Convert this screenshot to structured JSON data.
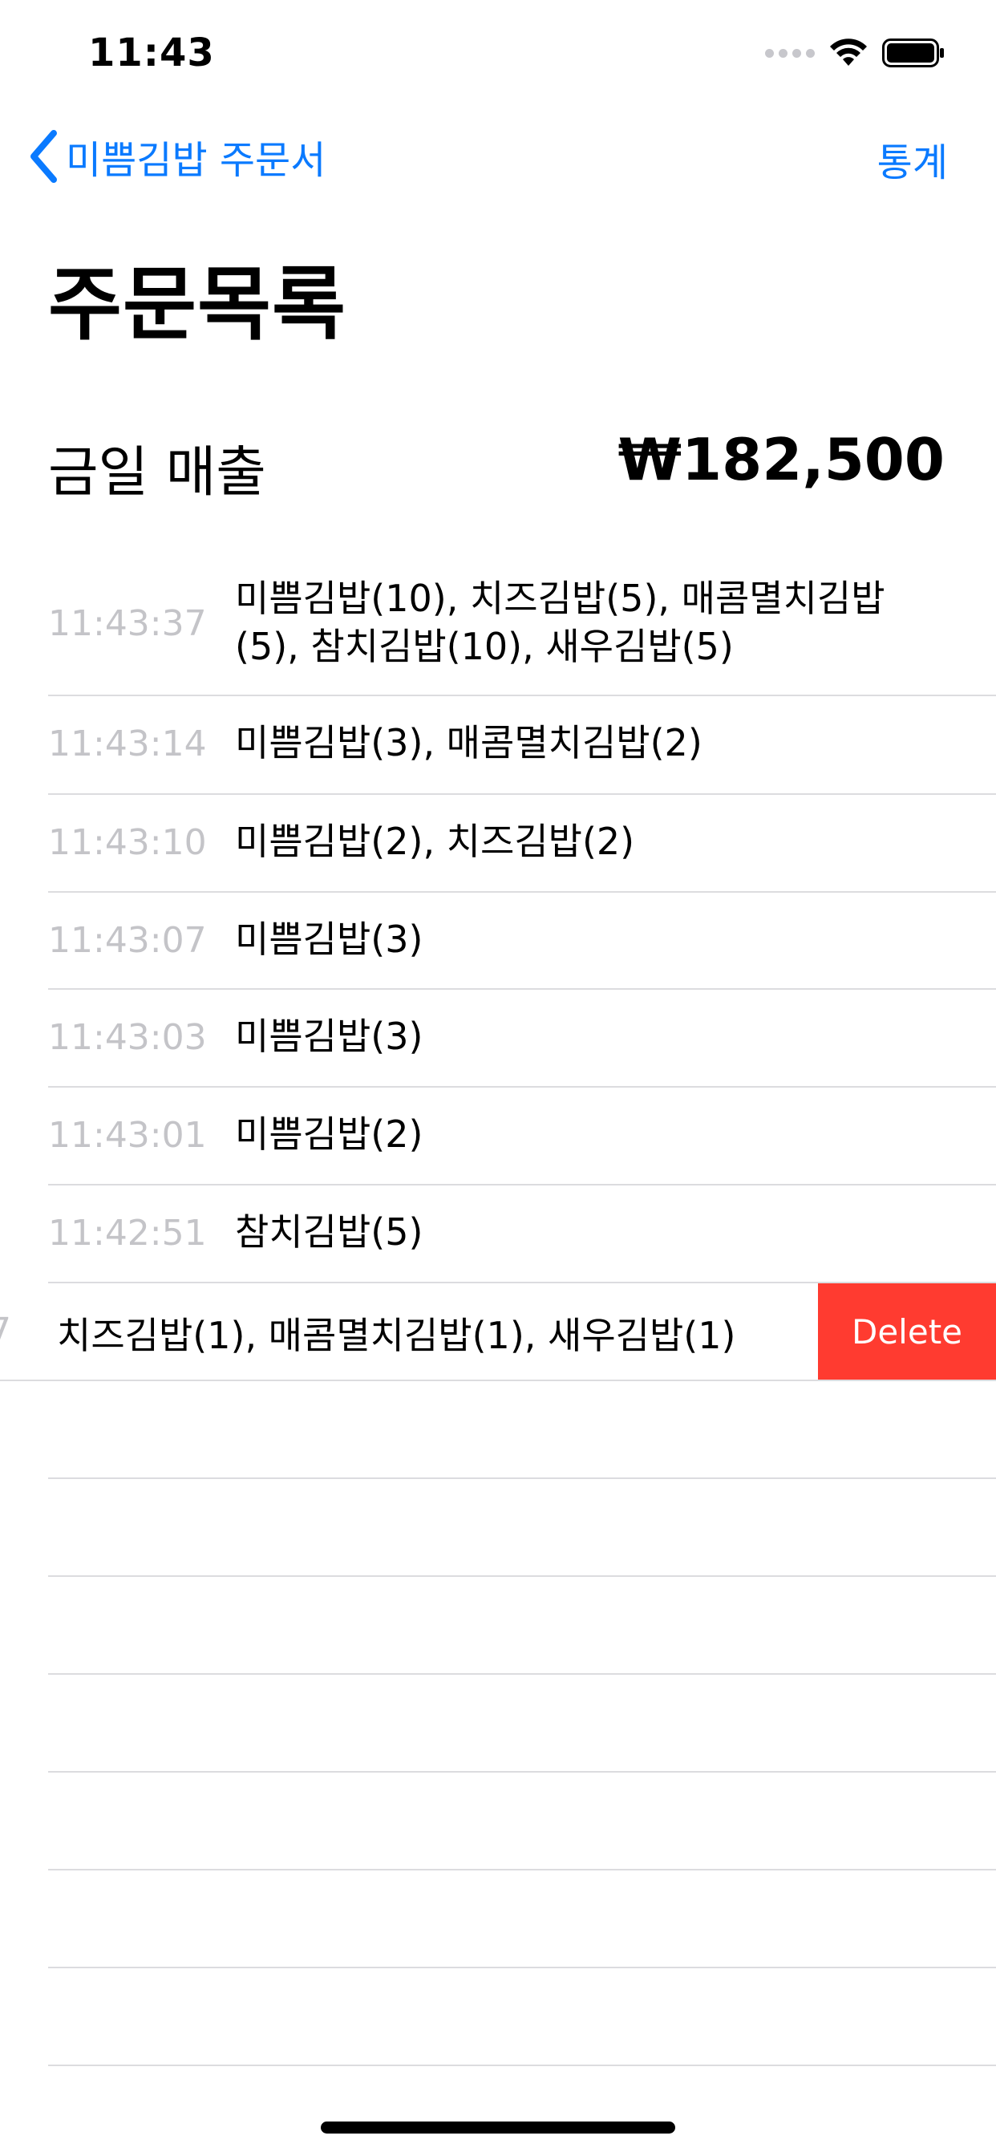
{
  "status_bar": {
    "time": "11:43"
  },
  "nav": {
    "back_label": "미쁨김밥 주문서",
    "right_label": "통계"
  },
  "title": "주문목록",
  "sales": {
    "label": "금일 매출",
    "amount": "₩182,500"
  },
  "orders": [
    {
      "time": "11:43:37",
      "items": "미쁨김밥(10), 치즈김밥(5), 매콤멸치김밥(5), 참치김밥(10), 새우김밥(5)"
    },
    {
      "time": "11:43:14",
      "items": "미쁨김밥(3), 매콤멸치김밥(2)"
    },
    {
      "time": "11:43:10",
      "items": "미쁨김밥(2), 치즈김밥(2)"
    },
    {
      "time": "11:43:07",
      "items": "미쁨김밥(3)"
    },
    {
      "time": "11:43:03",
      "items": "미쁨김밥(3)"
    },
    {
      "time": "11:43:01",
      "items": "미쁨김밥(2)"
    },
    {
      "time": "11:42:51",
      "items": "참치김밥(5)"
    }
  ],
  "swiped_order": {
    "partial_time": "7",
    "items": "치즈김밥(1), 매콤멸치김밥(1), 새우김밥(1)",
    "delete_label": "Delete"
  },
  "colors": {
    "accent": "#0a7aff",
    "delete": "#ff3b30",
    "secondary_text": "#c4c4c8"
  },
  "icons": {
    "back": "chevron-left-icon",
    "wifi": "wifi-icon",
    "battery": "battery-icon",
    "signal": "cellular-signal-icon"
  }
}
